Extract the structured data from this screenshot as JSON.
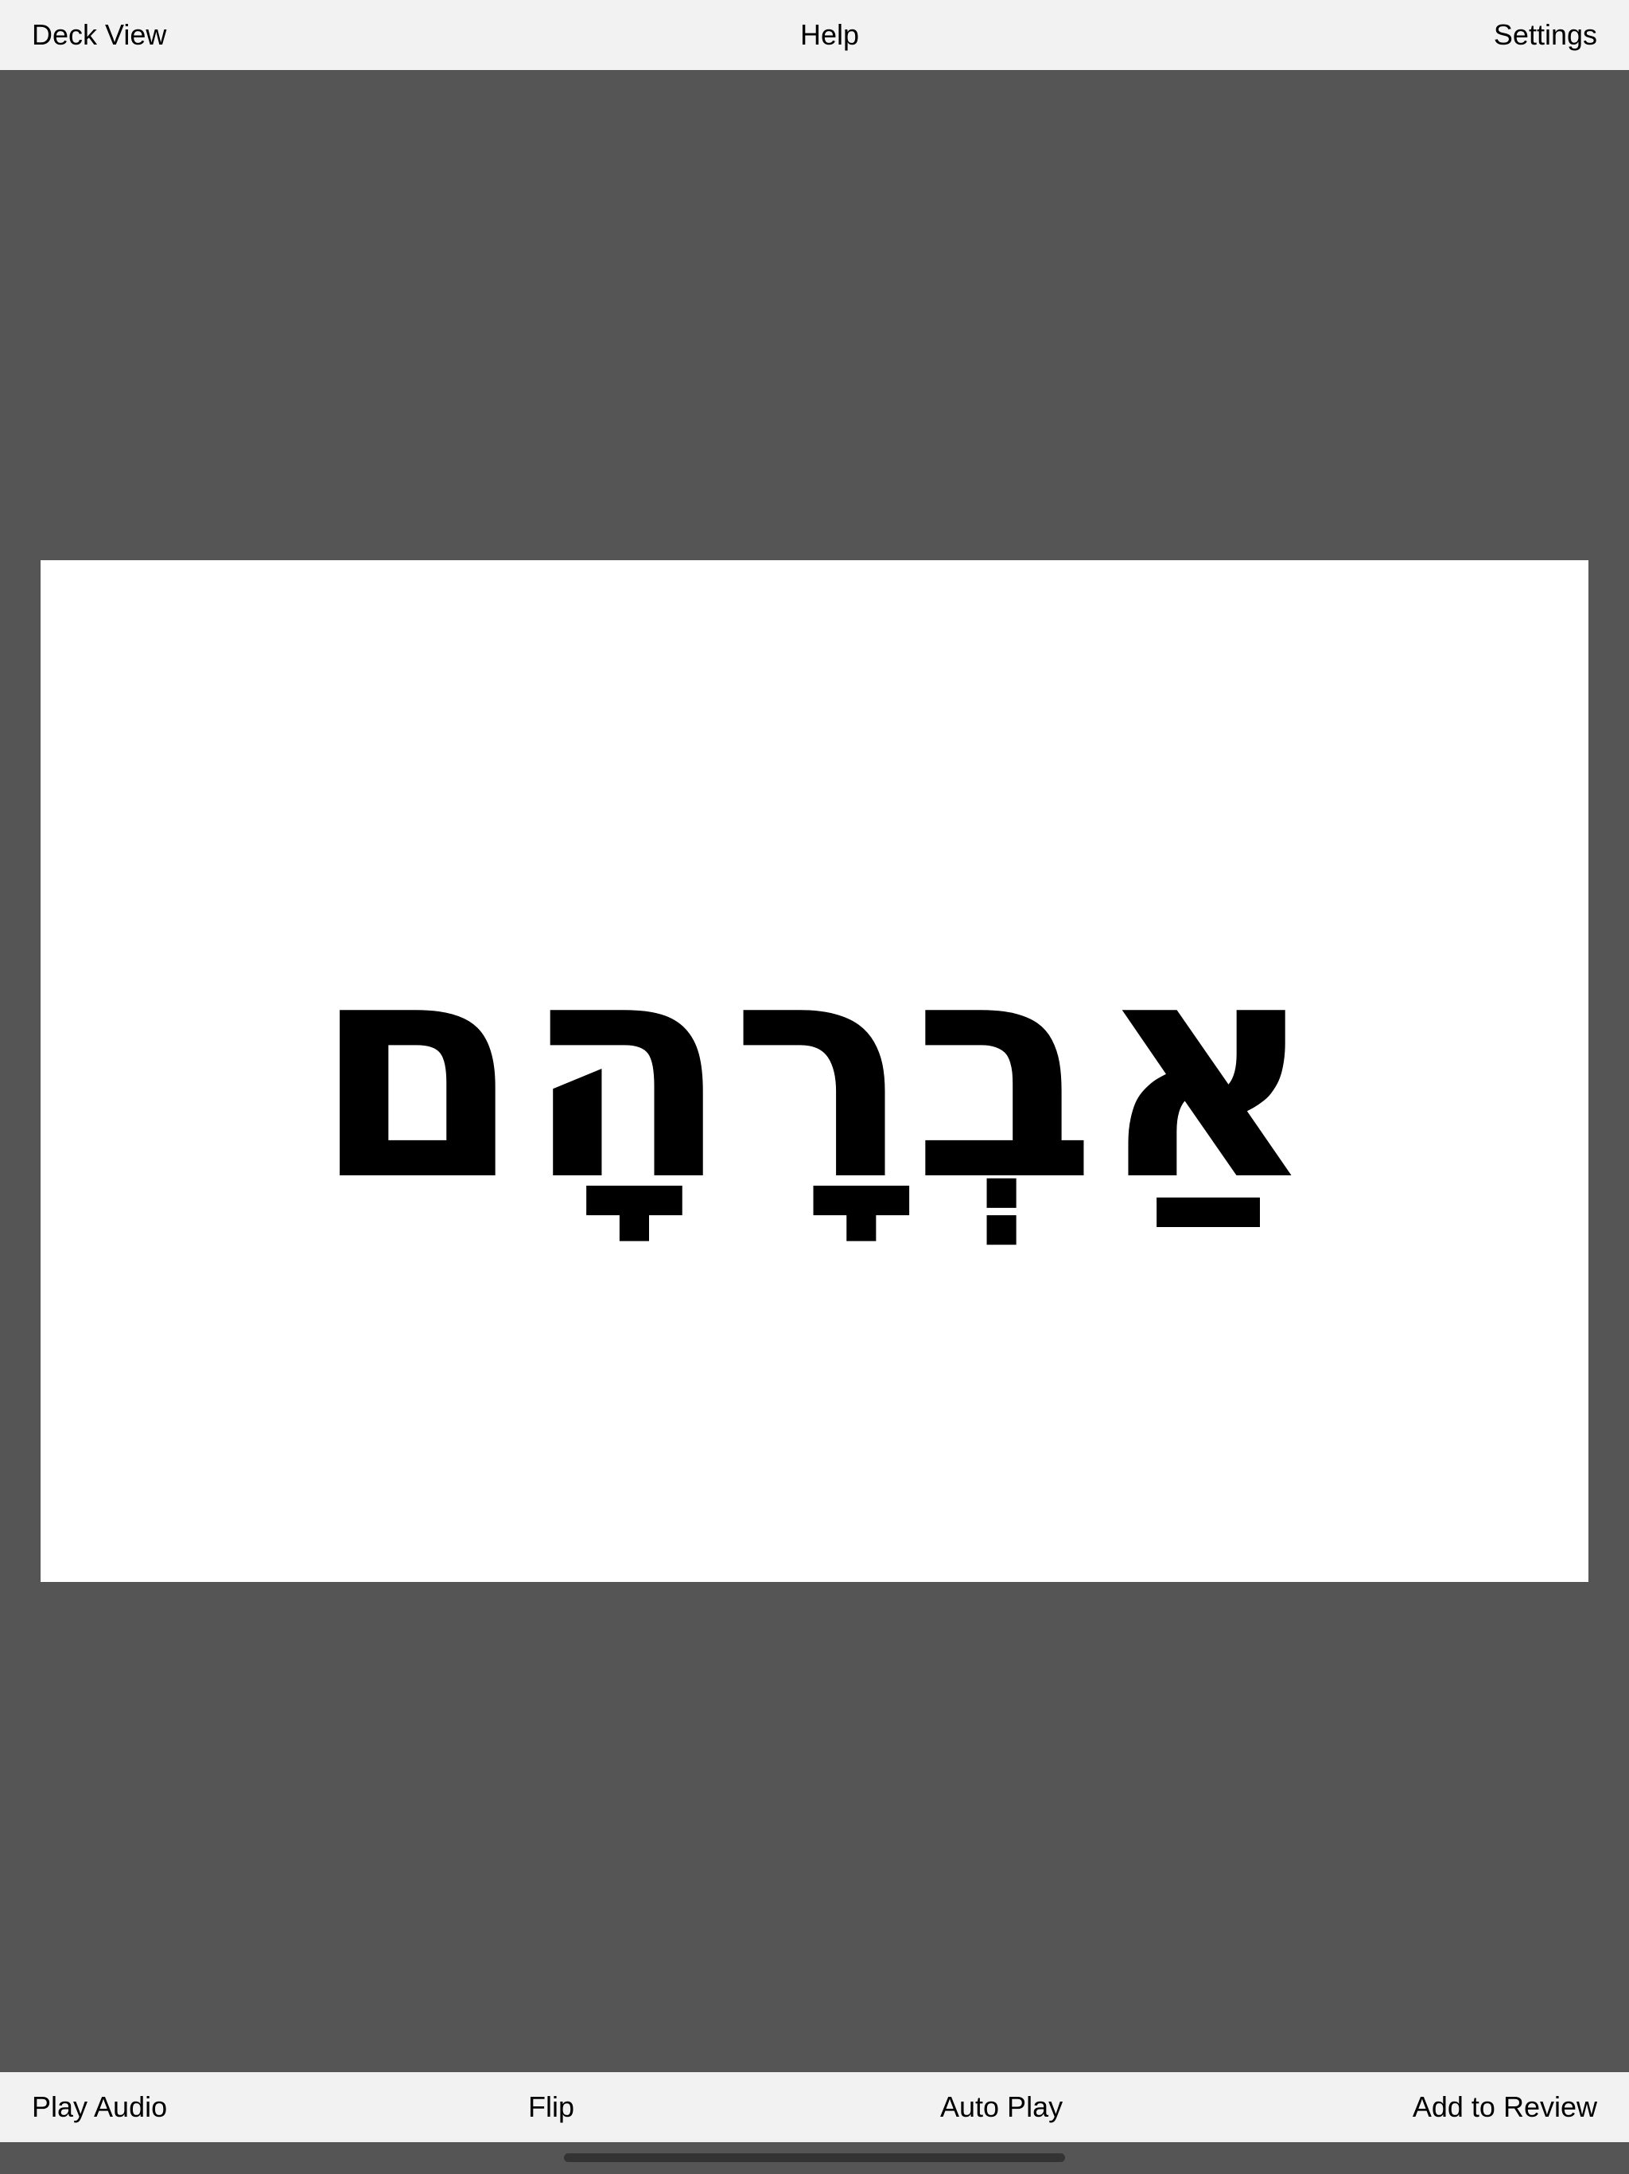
{
  "top_bar": {
    "deck_view_label": "Deck View",
    "help_label": "Help",
    "settings_label": "Settings"
  },
  "card": {
    "word": "אַבְרָהָם"
  },
  "bottom_bar": {
    "play_audio_label": "Play Audio",
    "flip_label": "Flip",
    "auto_play_label": "Auto Play",
    "add_to_review_label": "Add to Review"
  },
  "colors": {
    "background": "#555555",
    "bar_background": "#f2f2f2",
    "card_background": "#ffffff",
    "text": "#000000"
  }
}
